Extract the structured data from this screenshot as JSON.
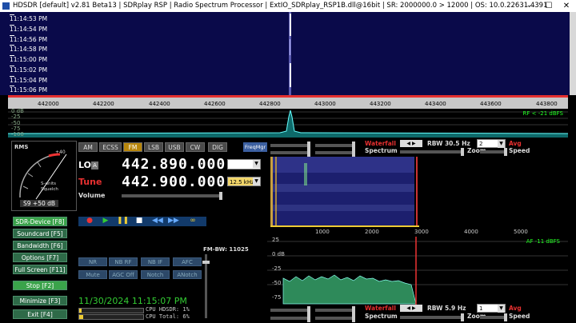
{
  "window": {
    "title": "HDSDR  [default]  v2.81 Beta13  |  SDRplay RSP  |  Radio Spectrum Processor  |  ExtIO_SDRplay_RSP1B.dll@16bit  |  SR: 2000000.0 > 12000  |  OS: 10.0.22631.4391",
    "min": "—",
    "max": "☐",
    "close": "✕"
  },
  "waterfall": {
    "times": [
      "11:14:53 PM",
      "11:14:54 PM",
      "11:14:56 PM",
      "11:14:58 PM",
      "11:15:00 PM",
      "11:15:02 PM",
      "11:15:04 PM",
      "11:15:06 PM"
    ]
  },
  "rf_scale": {
    "ticks": [
      "442000",
      "442200",
      "442400",
      "442600",
      "442800",
      "443000",
      "443200",
      "443400",
      "443600",
      "443800"
    ]
  },
  "spectrum": {
    "db_labels": [
      "0 dB",
      "-25",
      "-50",
      "-75",
      "-100"
    ],
    "rf_level": "RF < -21 dBFS"
  },
  "meter": {
    "rms": "RMS",
    "scale": "+40",
    "s_units": "S-units",
    "squelch": "Squelch",
    "reading": "S9 +50 dB"
  },
  "modes": [
    "AM",
    "ECSS",
    "FM",
    "LSB",
    "USB",
    "CW",
    "DIG"
  ],
  "active_mode": "FM",
  "freqmgr": "FreqMgr",
  "lo": {
    "label": "LO",
    "tag": "A",
    "value": "442.890.000"
  },
  "tune": {
    "label": "Tune",
    "value": "442.900.000",
    "step": "12.5 kHz"
  },
  "volume": {
    "label": "Volume"
  },
  "side_buttons": [
    {
      "label": "SDR-Device",
      "key": "[F8]"
    },
    {
      "label": "Soundcard",
      "key": "[F5]"
    },
    {
      "label": "Bandwidth",
      "key": "[F6]"
    },
    {
      "label": "Options",
      "key": "[F7]"
    },
    {
      "label": "Full Screen",
      "key": "[F11]"
    },
    {
      "label": "Stop",
      "key": "[F2]"
    },
    {
      "label": "Minimize",
      "key": "[F3]"
    },
    {
      "label": "Exit",
      "key": "[F4]"
    }
  ],
  "dsp": {
    "row1": [
      "NR",
      "NB RF",
      "NB IF",
      "AFC"
    ],
    "row2": [
      "Mute",
      "AGC Off",
      "Notch",
      "ANotch"
    ]
  },
  "fm_bw": "FM-BW: 11025",
  "clock": "11/30/2024 11:15:07 PM",
  "cpu": {
    "hdsdr": "CPU HDSDR:  1%",
    "total": "CPU Total:  6%"
  },
  "rf_controls": {
    "waterfall": "Waterfall",
    "spectrum": "Spectrum",
    "rbw": "RBW 30.5 Hz",
    "zoom": "Zoom",
    "avg_val": "2",
    "avg": "Avg",
    "speed": "Speed"
  },
  "af_scale": {
    "ticks": [
      "1000",
      "2000",
      "3000",
      "4000",
      "5000"
    ]
  },
  "af_spec": {
    "db": [
      "25",
      "0 dB",
      "-25",
      "-50",
      "-75"
    ],
    "af_level": "AF -11 dBFS"
  },
  "af_controls": {
    "waterfall": "Waterfall",
    "spectrum": "Spectrum",
    "rbw": "RBW  5.9 Hz",
    "zoom": "Zoom",
    "avg_val": "1",
    "avg": "Avg",
    "speed": "Speed"
  },
  "colors": {
    "active_mode": "#b8860b",
    "btn_green": "#2e6a48",
    "lo_text": "#ffffff",
    "tune_label": "#e83030"
  }
}
